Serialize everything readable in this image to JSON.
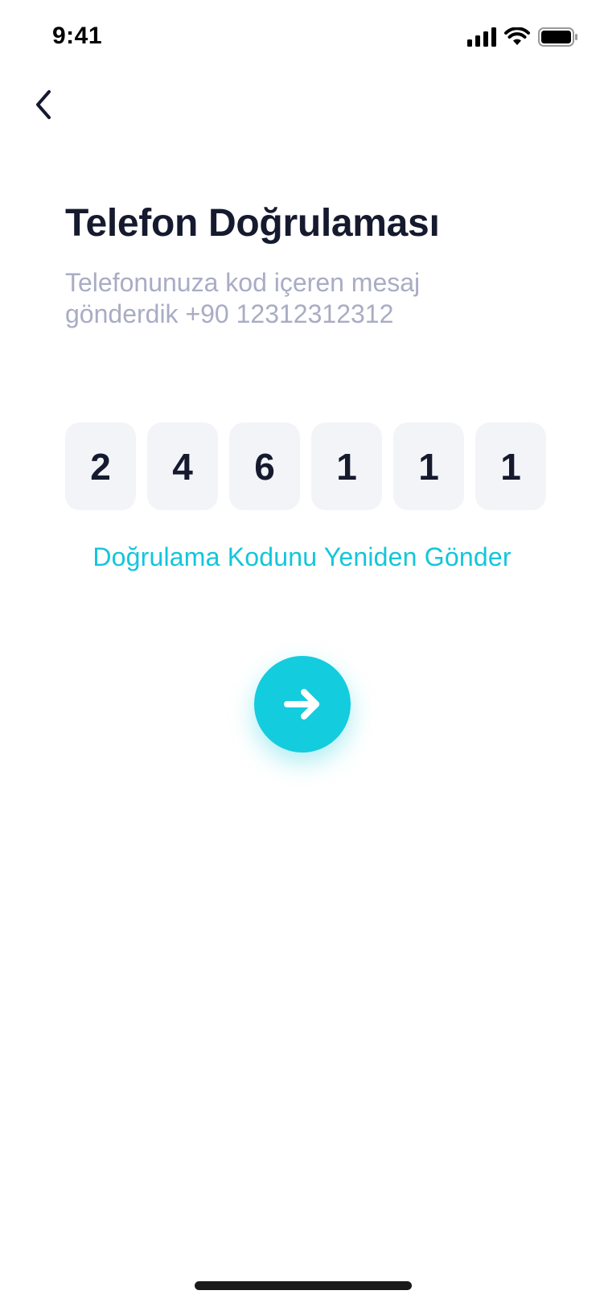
{
  "status_bar": {
    "time": "9:41"
  },
  "header": {
    "back_icon": "chevron-left-icon"
  },
  "main": {
    "title": "Telefon Doğrulaması",
    "subtitle": "Telefonunuza kod içeren mesaj gönderdik +90 12312312312",
    "code_digits": [
      "2",
      "4",
      "6",
      "1",
      "1",
      "1"
    ],
    "resend_label": "Doğrulama Kodunu Yeniden Gönder",
    "next_icon": "arrow-right-icon"
  },
  "colors": {
    "accent": "#13CCDE",
    "title": "#151A2E",
    "subtitle": "#A9ACC4",
    "code_box_bg": "#F3F4F8"
  }
}
